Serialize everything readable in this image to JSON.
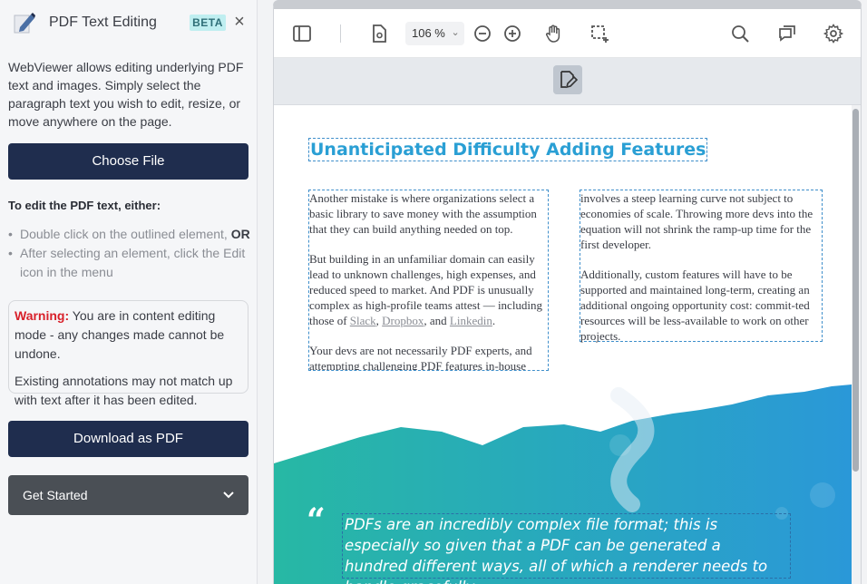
{
  "sidebar": {
    "title": "PDF Text Editing",
    "badge": "BETA",
    "close_icon": "×",
    "intro": "WebViewer allows editing underlying PDF text and images. Simply select the paragraph text you wish to edit, resize, or move anywhere on the page.",
    "choose_file_label": "Choose File",
    "edit_title": "To edit the PDF text, either:",
    "instructions": [
      {
        "text": "Double click on the outlined element, ",
        "bold": "OR"
      },
      {
        "text": "After selecting an element, click the Edit icon in the menu",
        "bold": ""
      }
    ],
    "warning": {
      "label": "Warning:",
      "text": " You are in content editing mode - any changes made cannot be undone.",
      "text2": "Existing annotations may not match up with text after it has been edited."
    },
    "download_label": "Download as PDF",
    "get_started_label": "Get Started",
    "get_started_chevron": "⌄"
  },
  "toolbar": {
    "zoom_value": "106 %",
    "zoom_chevron": "⌄",
    "icons": [
      "sidebar-toggle-icon",
      "page-settings-icon",
      "zoom-out-icon",
      "zoom-in-icon",
      "pan-hand-icon",
      "marquee-select-icon",
      "search-icon",
      "comments-icon",
      "settings-gear-icon"
    ]
  },
  "subbar": {
    "active_tool": "edit-content-icon"
  },
  "document": {
    "title": "Unanticipated Difficulty Adding Features",
    "col1_p1": "Another mistake is where organizations select a basic library to save money with the assumption that they can build anything needed on top.",
    "col1_p2_pre": "But building in an unfamiliar domain can easily lead to unknown challenges, high expenses, and reduced speed to market. And PDF is unusually complex as high-profile teams attest — including those of ",
    "link_slack": "Slack",
    "sep1": ", ",
    "link_dropbox": "Dropbox",
    "sep2": ", and ",
    "link_linkedin": "Linkedin",
    "end": ".",
    "col1_p3": "Your devs are not necessarily PDF experts, and attempting challenging PDF features in-house",
    "col2_p1": "involves a steep learning curve not subject to economies of scale. Throwing more devs into the equation will not shrink the ramp-up time for the first developer.",
    "col2_p2": "Additionally, custom features will have to be supported and maintained long-term, creating an additional ongoing opportunity cost: commit-ted resources will be less-available to work on other projects.",
    "quote_mark": "“",
    "quote": "PDFs are an incredibly complex file format; this is especially so given that a PDF can be generated a hundred different ways, all of which a renderer needs to handle gracefully."
  },
  "colors": {
    "primary_button": "#1f2d4e",
    "accent_title": "#2a9fd4",
    "warning_red": "#d8202a",
    "badge_bg": "#bfeef0",
    "wave_start": "#27b8a4",
    "wave_end": "#2a98d8"
  }
}
